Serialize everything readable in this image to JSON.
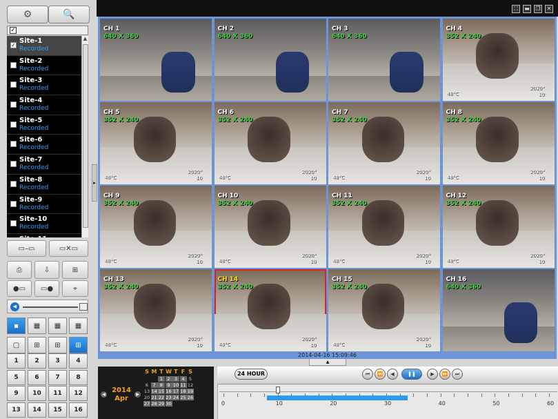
{
  "window": {
    "buttons": [
      "fullscreen",
      "minimize",
      "restore",
      "close"
    ]
  },
  "sites": [
    {
      "name": "Site-1",
      "status": "Recorded",
      "checked": true
    },
    {
      "name": "Site-2",
      "status": "Recorded",
      "checked": false
    },
    {
      "name": "Site-3",
      "status": "Recorded",
      "checked": false
    },
    {
      "name": "Site-4",
      "status": "Recorded",
      "checked": false
    },
    {
      "name": "Site-5",
      "status": "Recorded",
      "checked": false
    },
    {
      "name": "Site-6",
      "status": "Recorded",
      "checked": false
    },
    {
      "name": "Site-7",
      "status": "Recorded",
      "checked": false
    },
    {
      "name": "Site-8",
      "status": "Recorded",
      "checked": false
    },
    {
      "name": "Site-9",
      "status": "Recorded",
      "checked": false
    },
    {
      "name": "Site-10",
      "status": "Recorded",
      "checked": false
    },
    {
      "name": "Site-11",
      "status": "",
      "checked": false
    }
  ],
  "channels": [
    {
      "ch": "CH 1",
      "res": "640 X 360"
    },
    {
      "ch": "CH 2",
      "res": "640 X 360"
    },
    {
      "ch": "CH 3",
      "res": "640 X 360"
    },
    {
      "ch": "CH 4",
      "res": "352 X 240"
    },
    {
      "ch": "CH 5",
      "res": "352 X 240"
    },
    {
      "ch": "CH 6",
      "res": "352 X 240"
    },
    {
      "ch": "CH 7",
      "res": "352 X 240"
    },
    {
      "ch": "CH 8",
      "res": "352 X 240"
    },
    {
      "ch": "CH 9",
      "res": "352 X 240"
    },
    {
      "ch": "CH 10",
      "res": "352 X 240"
    },
    {
      "ch": "CH 11",
      "res": "352 X 240"
    },
    {
      "ch": "CH 12",
      "res": "352 X 240"
    },
    {
      "ch": "CH 13",
      "res": "352 X 240"
    },
    {
      "ch": "CH 14",
      "res": "352 X 240"
    },
    {
      "ch": "CH 15",
      "res": "352 X 240"
    },
    {
      "ch": "CH 16",
      "res": "640 X 360"
    }
  ],
  "overlay": {
    "temp": "48°C",
    "info1": "2020°",
    "info2": "10"
  },
  "timestamp": "2014-04-16 15:09:46",
  "numbers": [
    "1",
    "2",
    "3",
    "4",
    "5",
    "6",
    "7",
    "8",
    "9",
    "10",
    "11",
    "12",
    "13",
    "14",
    "15",
    "16"
  ],
  "calendar": {
    "year": "2014",
    "month": "Apr",
    "headers": [
      "S",
      "M",
      "T",
      "W",
      "T",
      "F",
      "S"
    ],
    "rows": [
      [
        "",
        "",
        "1",
        "2",
        "3",
        "4",
        "5"
      ],
      [
        "6",
        "7",
        "8",
        "9",
        "10",
        "11",
        "12"
      ],
      [
        "13",
        "14",
        "15",
        "16",
        "17",
        "18",
        "19"
      ],
      [
        "20",
        "21",
        "22",
        "23",
        "24",
        "25",
        "26"
      ],
      [
        "27",
        "28",
        "29",
        "30",
        "",
        "",
        ""
      ]
    ]
  },
  "timeline": {
    "hour_button": "24 HOUR",
    "labels": [
      "0",
      "10",
      "20",
      "30",
      "40",
      "50",
      "60"
    ],
    "recorded_from": 8,
    "recorded_to": 34,
    "cursor": 10,
    "accent": "#2a9af0"
  }
}
